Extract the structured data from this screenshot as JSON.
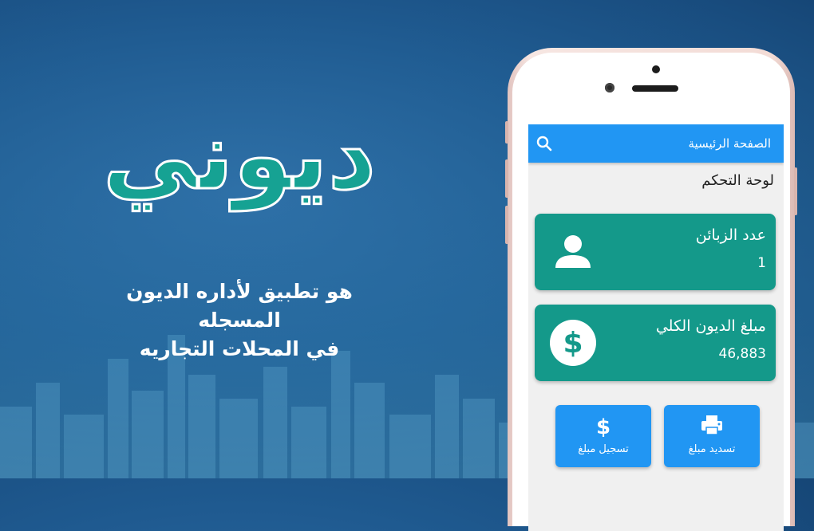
{
  "promo": {
    "logo_text": "ديوني",
    "tagline_line1": "هو تطبيق لأداره الديون المسجله",
    "tagline_line2": "في المحلات التجاريه"
  },
  "app": {
    "appbar_title": "الصفحة الرئيسية",
    "section_title": "لوحة التحكم",
    "cards": [
      {
        "label": "عدد الزبائن",
        "value": "1",
        "icon": "person-icon"
      },
      {
        "label": "مبلغ الديون الكلي",
        "value": "46,883",
        "icon": "dollar-circle-icon"
      }
    ],
    "actions": [
      {
        "label": "تسجيل مبلغ",
        "icon": "dollar-icon"
      },
      {
        "label": "تسديد مبلغ",
        "icon": "printer-icon"
      }
    ]
  },
  "colors": {
    "background": "#1f5a90",
    "appbar": "#2196f3",
    "card": "#14998a",
    "logo": "#16a293",
    "phone_frame": "#f3dcd6"
  }
}
